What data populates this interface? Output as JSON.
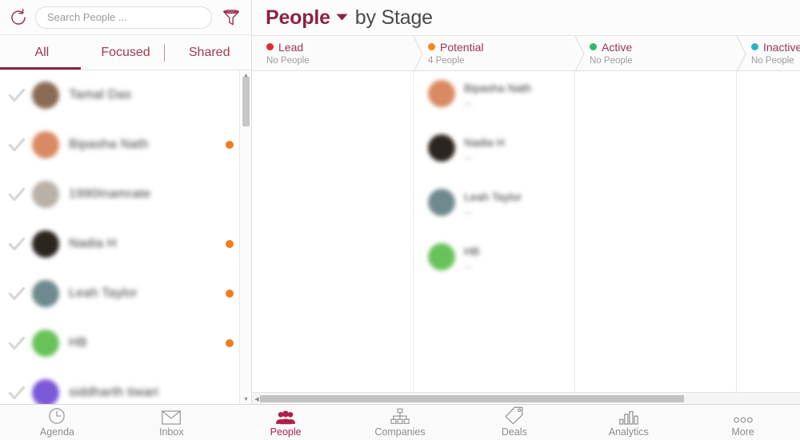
{
  "theme": {
    "brand": "#8c2344",
    "brand_light": "#a33a52",
    "active_tab": "#b01e4a",
    "muted": "#9a9a9a"
  },
  "left_panel": {
    "refresh_icon": "refresh-icon",
    "filter_icon": "funnel-filter-icon",
    "search": {
      "placeholder": "Search People ...",
      "value": ""
    },
    "tabs": [
      {
        "label": "All",
        "active": true
      },
      {
        "label": "Focused",
        "active": false
      },
      {
        "label": "Shared",
        "active": false
      }
    ],
    "people": [
      {
        "name": "Tamal Das",
        "avatar_color": "#8a6c55",
        "dot": null
      },
      {
        "name": "Bipasha Nath",
        "avatar_color": "#d98a62",
        "dot": "#ef7d1e"
      },
      {
        "name": "1990Inamrate",
        "avatar_color": "#b9b0a8",
        "dot": null
      },
      {
        "name": "Nadia H",
        "avatar_color": "#2b2520",
        "dot": "#ef7d1e"
      },
      {
        "name": "Leah Taylor",
        "avatar_color": "#6f8a8e",
        "dot": "#ef7d1e"
      },
      {
        "name": "HB",
        "avatar_color": "#68c25a",
        "dot": "#ef7d1e"
      },
      {
        "name": "siddharth tiwari",
        "avatar_color": "#7a5ad6",
        "dot": null
      }
    ]
  },
  "main": {
    "title": "People",
    "title_caret": "chevron-down-icon",
    "subtitle": "by Stage",
    "stages": [
      {
        "name": "Lead",
        "color": "#e02b2b",
        "count_label": "No People",
        "cards": []
      },
      {
        "name": "Potential",
        "color": "#f08820",
        "count_label": "4 People",
        "cards": [
          {
            "name": "Bipasha Nath",
            "sub": "—",
            "avatar_color": "#d98a62"
          },
          {
            "name": "Nadia H",
            "sub": "—",
            "avatar_color": "#2b2520"
          },
          {
            "name": "Leah Taylor",
            "sub": "—",
            "avatar_color": "#6f8a8e"
          },
          {
            "name": "HB",
            "sub": "—",
            "avatar_color": "#68c25a"
          }
        ]
      },
      {
        "name": "Active",
        "color": "#2eb872",
        "count_label": "No People",
        "cards": []
      },
      {
        "name": "Inactive",
        "color": "#2bb3c9",
        "count_label": "No People",
        "cards": []
      }
    ],
    "h_scrollbar": {
      "name": "horizontal-scrollbar"
    }
  },
  "tabbar": [
    {
      "label": "Agenda",
      "icon": "clock-icon",
      "active": false
    },
    {
      "label": "Inbox",
      "icon": "envelope-icon",
      "active": false
    },
    {
      "label": "People",
      "icon": "people-icon",
      "active": true
    },
    {
      "label": "Companies",
      "icon": "org-chart-icon",
      "active": false
    },
    {
      "label": "Deals",
      "icon": "tag-icon",
      "active": false
    },
    {
      "label": "Analytics",
      "icon": "bar-chart-icon",
      "active": false
    },
    {
      "label": "More",
      "icon": "ellipsis-icon",
      "active": false
    }
  ]
}
